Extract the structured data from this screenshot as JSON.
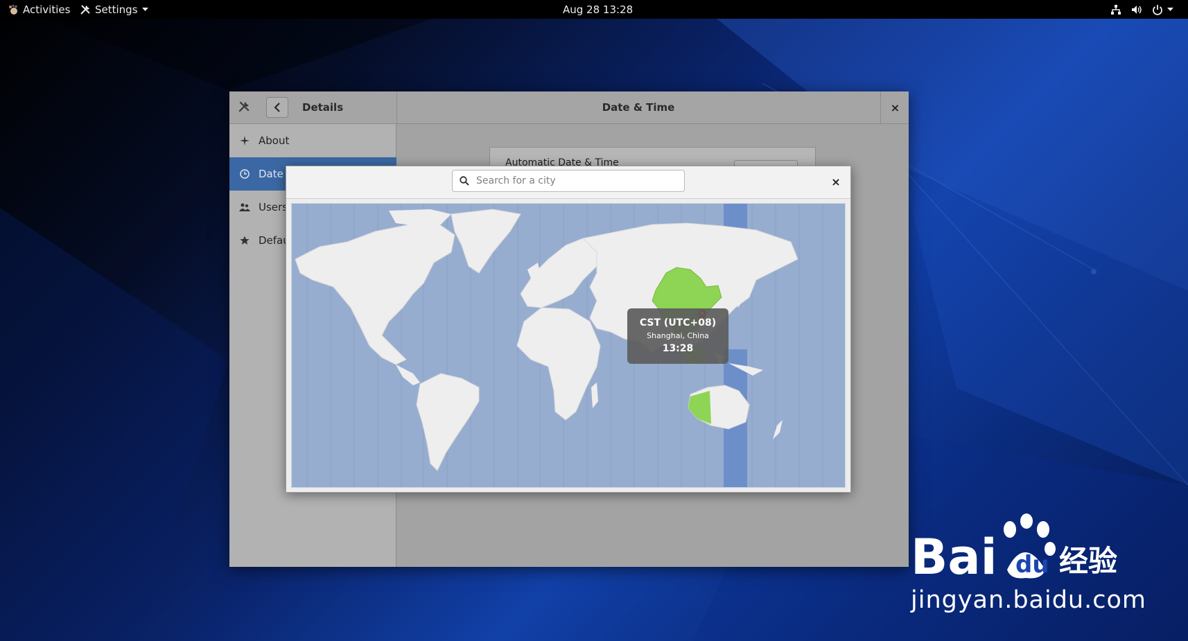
{
  "topbar": {
    "activities_label": "Activities",
    "app_menu_label": "Settings",
    "clock": "Aug 28  13:28"
  },
  "settings_window": {
    "panel_title": "Details",
    "main_title": "Date & Time",
    "close_glyph": "×",
    "sidebar": {
      "items": [
        {
          "label": "About",
          "icon": "star-sparkle-icon"
        },
        {
          "label": "Date &",
          "icon": "clock-icon",
          "active": true
        },
        {
          "label": "Users",
          "icon": "users-icon"
        },
        {
          "label": "Defaul",
          "icon": "star-icon"
        }
      ]
    },
    "content": {
      "automatic_label": "Automatic Date & Time"
    }
  },
  "timezone_dialog": {
    "search_placeholder": "Search for a city",
    "close_glyph": "×",
    "tooltip": {
      "timezone": "CST (UTC+08)",
      "city": "Shanghai, China",
      "time": "13:28"
    }
  },
  "colors": {
    "accent": "#3b68a4",
    "map_ocean": "#97add0",
    "map_land": "#efeeee",
    "tz_highlight_band": "#6d8fc9",
    "selected_zone_land": "#8ed455",
    "pin": "#e53030"
  },
  "watermark": {
    "brand": "Bai",
    "brand_suffix": "经验",
    "url": "jingyan.baidu.com"
  }
}
